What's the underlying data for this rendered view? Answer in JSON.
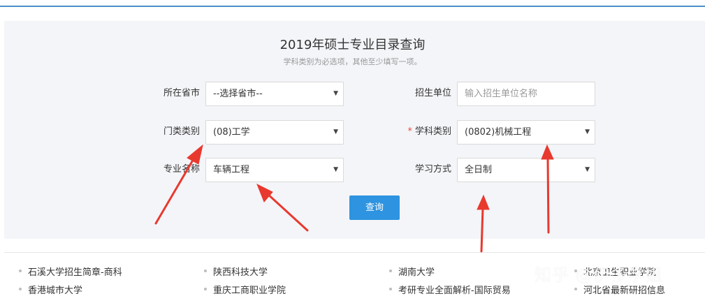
{
  "header": {
    "title": "2019年硕士专业目录查询",
    "subtitle": "学科类别为必选项，其他至少填写一项。"
  },
  "form": {
    "province_label": "所在省市",
    "province_value": "--选择省市--",
    "unit_label": "招生单位",
    "unit_placeholder": "输入招生单位名称",
    "category_label": "门类类别",
    "category_value": "(08)工学",
    "discipline_required_mark": "*",
    "discipline_label": "学科类别",
    "discipline_value": "(0802)机械工程",
    "major_label": "专业名称",
    "major_value": "车辆工程",
    "study_mode_label": "学习方式",
    "study_mode_value": "全日制",
    "query_button": "查询",
    "dropdown_caret": "▼"
  },
  "links": [
    "石溪大学招生简章-商科",
    "陕西科技大学",
    "湖南大学",
    "北京卫生职业学院",
    "香港城市大学",
    "重庆工商职业学院",
    "考研专业全面解析-国际贸易",
    "河北省最新研招信息"
  ],
  "watermark": "知乎 @伊多学姐",
  "colors": {
    "accent": "#2e93e0",
    "arrow": "#e8392f",
    "panel": "#f4f5f8"
  }
}
